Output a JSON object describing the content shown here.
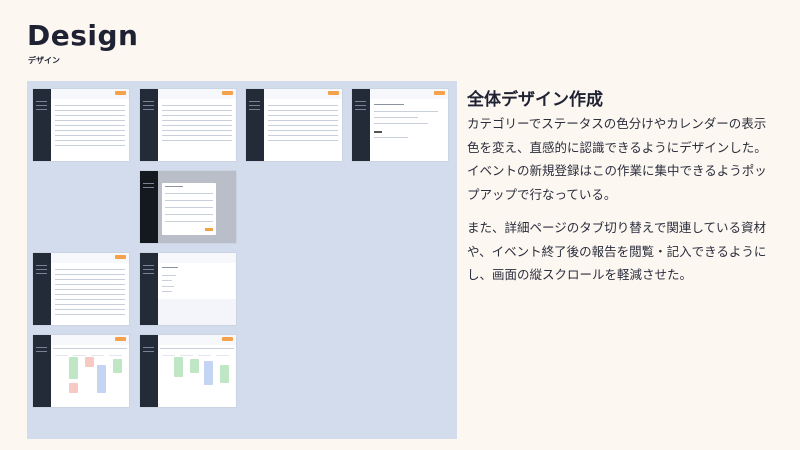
{
  "page": {
    "title": "Design",
    "subtitle": "デザイン"
  },
  "section": {
    "heading": "全体デザイン作成",
    "paragraph1": "カテゴリーでステータスの色分けやカレンダーの表示色を変え、直感的に認識できるようにデザインした。イベントの新規登録はこの作業に集中できるようポップアップで行なっている。",
    "paragraph2": "また、詳細ページのタブ切り替えで関連している資材や、イベント終了後の報告を閲覧・記入できるようにし、画面の縦スクロールを軽減させた。"
  },
  "board": {
    "background": "#d3dcec",
    "thumbnails": [
      {
        "kind": "list"
      },
      {
        "kind": "list"
      },
      {
        "kind": "list"
      },
      {
        "kind": "detail"
      },
      {
        "kind": "modal"
      },
      {
        "kind": "list"
      },
      {
        "kind": "detail"
      },
      {
        "kind": "calendar"
      },
      {
        "kind": "calendar"
      }
    ]
  },
  "colors": {
    "page_background": "#fdf7f1",
    "sidebar": "#232a38",
    "accent": "#f5a04a",
    "event_green": "#bfe7c5",
    "event_pink": "#f6c9c2",
    "event_blue": "#c4d4f3"
  }
}
